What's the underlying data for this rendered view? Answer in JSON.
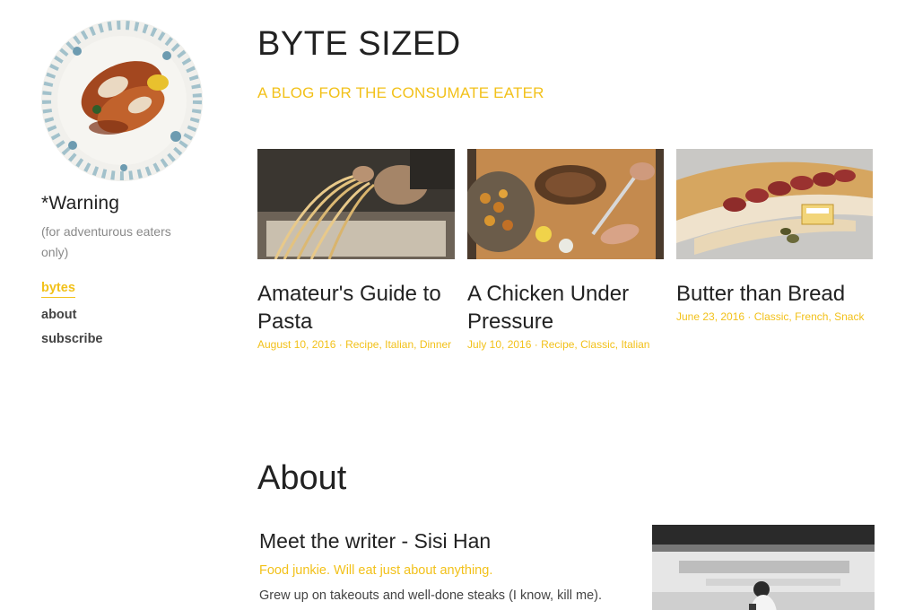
{
  "sidebar": {
    "avatar_alt": "plate of food",
    "title": "*Warning",
    "subtitle": "(for adventurous eaters only)",
    "nav": [
      {
        "label": "bytes",
        "active": true
      },
      {
        "label": "about",
        "active": false
      },
      {
        "label": "subscribe",
        "active": false
      }
    ]
  },
  "header": {
    "title": "BYTE SIZED",
    "tagline": "A BLOG FOR THE CONSUMATE EATER"
  },
  "posts": [
    {
      "title": "Amateur's Guide to Pasta",
      "date": "August 10, 2016",
      "separator": " · ",
      "tags": [
        "Recipe",
        "Italian",
        "Dinner"
      ],
      "image": "pasta-making-photo"
    },
    {
      "title": "A Chicken Under Pressure",
      "date": "July 10, 2016",
      "separator": " · ",
      "tags": [
        "Recipe",
        "Classic",
        "Italian"
      ],
      "image": "carving-board-photo"
    },
    {
      "title": "Butter than Bread",
      "date": "June 23, 2016",
      "separator": " · ",
      "tags": [
        "Classic",
        "French",
        "Snack"
      ],
      "image": "baguette-salami-photo"
    }
  ],
  "about": {
    "heading": "About",
    "writer_name": "Meet the writer - Sisi Han",
    "writer_tagline": "Food junkie. Will eat just about anything.",
    "writer_bio": "Grew up on takeouts and well-done steaks (I know, kill me).",
    "photo": "writer-photo"
  },
  "colors": {
    "accent": "#f2c11a",
    "text": "#222222",
    "muted": "#8a8a8a"
  }
}
